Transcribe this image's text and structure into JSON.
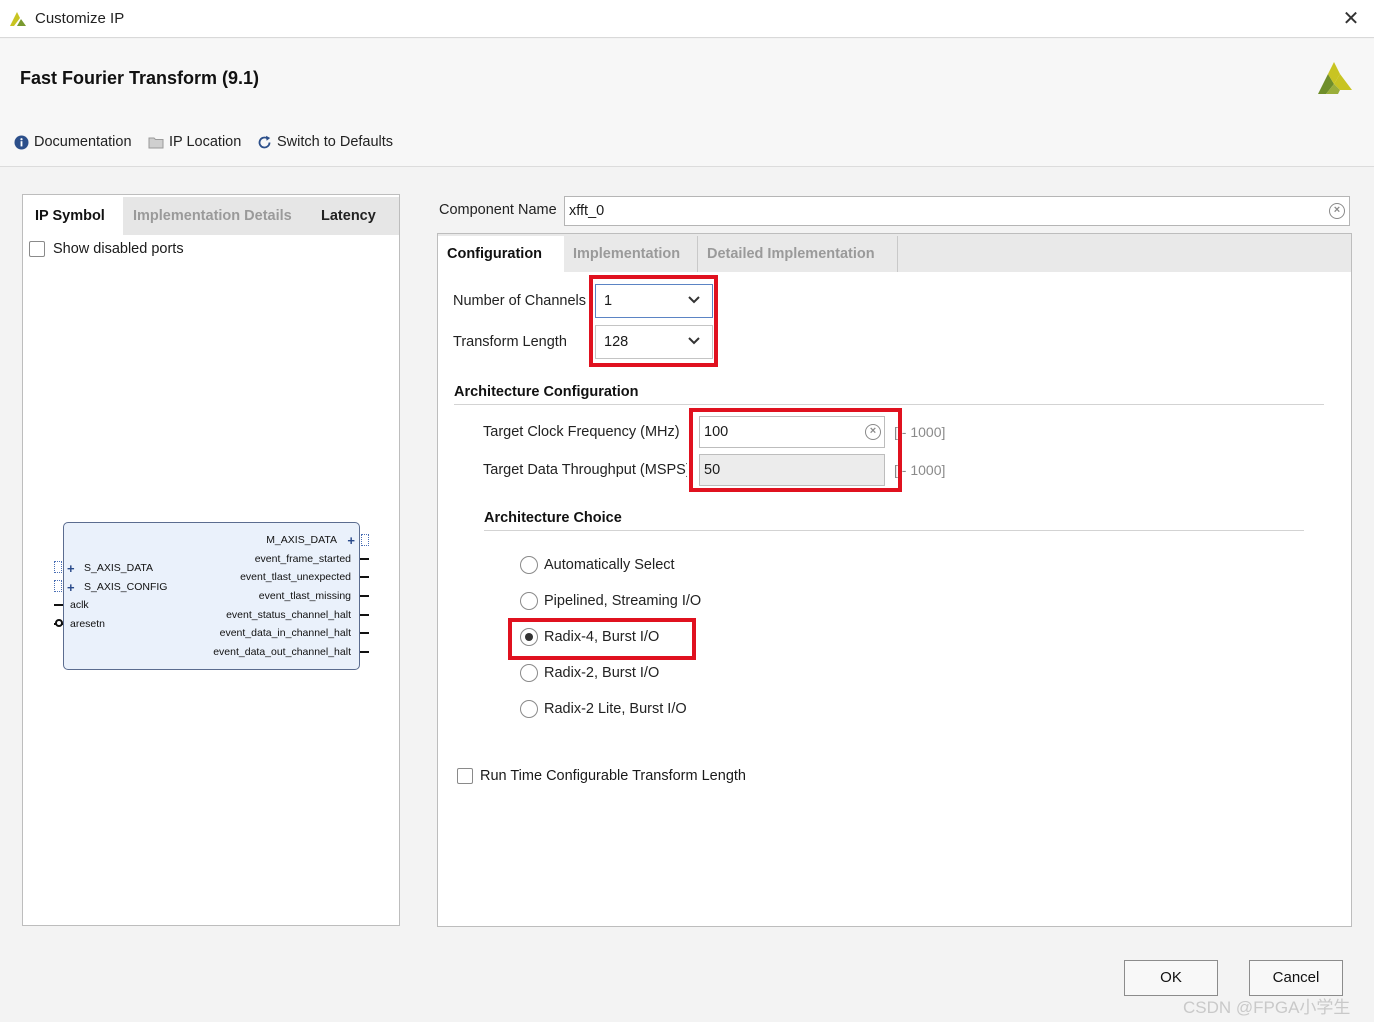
{
  "window": {
    "title": "Customize IP",
    "close_symbol": "✕"
  },
  "header": {
    "ip_title": "Fast Fourier Transform (9.1)"
  },
  "toolbar": {
    "documentation": "Documentation",
    "ip_location": "IP Location",
    "switch_defaults": "Switch to Defaults"
  },
  "left_panel": {
    "tabs": [
      {
        "label": "IP Symbol",
        "active": true
      },
      {
        "label": "Implementation Details",
        "active": false
      },
      {
        "label": "Latency",
        "active": false
      }
    ],
    "show_disabled_ports": {
      "label": "Show disabled ports",
      "checked": false
    },
    "ip_symbol": {
      "inputs": [
        {
          "name": "S_AXIS_DATA",
          "bus": true
        },
        {
          "name": "S_AXIS_CONFIG",
          "bus": true
        },
        {
          "name": "aclk",
          "bus": false
        },
        {
          "name": "aresetn",
          "bus": false
        }
      ],
      "outputs": [
        {
          "name": "M_AXIS_DATA",
          "bus": true
        },
        {
          "name": "event_frame_started",
          "bus": false
        },
        {
          "name": "event_tlast_unexpected",
          "bus": false
        },
        {
          "name": "event_tlast_missing",
          "bus": false
        },
        {
          "name": "event_status_channel_halt",
          "bus": false
        },
        {
          "name": "event_data_in_channel_halt",
          "bus": false
        },
        {
          "name": "event_data_out_channel_halt",
          "bus": false
        }
      ]
    }
  },
  "component": {
    "label": "Component Name",
    "value": "xfft_0"
  },
  "right_panel": {
    "tabs": [
      {
        "label": "Configuration",
        "active": true
      },
      {
        "label": "Implementation",
        "active": false
      },
      {
        "label": "Detailed Implementation",
        "active": false
      }
    ],
    "channels": {
      "label": "Number of Channels",
      "value": "1"
    },
    "transform_length": {
      "label": "Transform Length",
      "value": "128"
    },
    "arch_config": {
      "title": "Architecture Configuration",
      "clock": {
        "label": "Target Clock Frequency (MHz)",
        "value": "100",
        "range": "[  - 1000]"
      },
      "throughput": {
        "label": "Target Data Throughput (MSPS)",
        "value": "50",
        "range": "[  - 1000]"
      }
    },
    "arch_choice": {
      "title": "Architecture Choice",
      "options": [
        {
          "label": "Automatically Select",
          "selected": false
        },
        {
          "label": "Pipelined, Streaming I/O",
          "selected": false
        },
        {
          "label": "Radix-4, Burst I/O",
          "selected": true
        },
        {
          "label": "Radix-2, Burst I/O",
          "selected": false
        },
        {
          "label": "Radix-2 Lite, Burst I/O",
          "selected": false
        }
      ]
    },
    "runtime_config": {
      "label": "Run Time Configurable Transform Length",
      "checked": false
    }
  },
  "buttons": {
    "ok": "OK",
    "cancel": "Cancel"
  },
  "watermark": "CSDN @FPGA小学生",
  "colors": {
    "highlight": "#e0111f",
    "brand_yellow": "#c8c422",
    "brand_green": "#6f8e2a"
  },
  "icons": {
    "documentation": "info-icon",
    "ip_location": "folder-icon",
    "switch_defaults": "refresh-icon",
    "dropdown": "chevron-down-icon",
    "clear": "clear-circle-icon"
  }
}
